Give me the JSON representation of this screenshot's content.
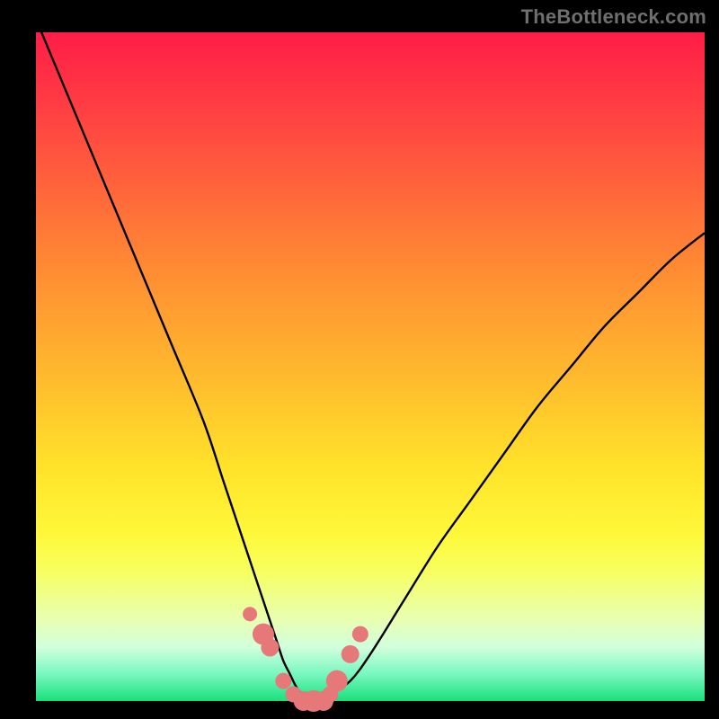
{
  "watermark": {
    "text": "TheBottleneck.com"
  },
  "chart_data": {
    "type": "line",
    "title": "",
    "xlabel": "",
    "ylabel": "",
    "xlim": [
      0,
      100
    ],
    "ylim": [
      0,
      100
    ],
    "series": [
      {
        "name": "bottleneck-curve",
        "x": [
          0,
          5,
          10,
          15,
          20,
          25,
          28,
          30,
          32,
          34,
          35,
          36,
          37,
          38,
          39,
          40,
          42,
          44,
          47,
          50,
          55,
          60,
          65,
          70,
          75,
          80,
          85,
          90,
          95,
          100
        ],
        "values": [
          102,
          90,
          78,
          66,
          54,
          42,
          33,
          27,
          21,
          15,
          12,
          9,
          6,
          4,
          2,
          1,
          0,
          1,
          3,
          7,
          15,
          23,
          30,
          37,
          44,
          50,
          56,
          61,
          66,
          70
        ]
      }
    ],
    "markers": {
      "name": "highlight-dots",
      "color": "#e6787a",
      "x": [
        32,
        34,
        35,
        37,
        38.5,
        40,
        41.5,
        43,
        44,
        45,
        47,
        48.5
      ],
      "values": [
        13,
        10,
        8,
        3,
        1,
        0,
        0,
        0,
        1,
        3,
        7,
        10
      ],
      "radius": [
        8,
        12,
        10,
        9,
        9,
        11,
        12,
        11,
        9,
        12,
        10,
        9
      ]
    },
    "background_gradient": {
      "top": "#ff1d47",
      "bottom": "#18e07b"
    }
  }
}
